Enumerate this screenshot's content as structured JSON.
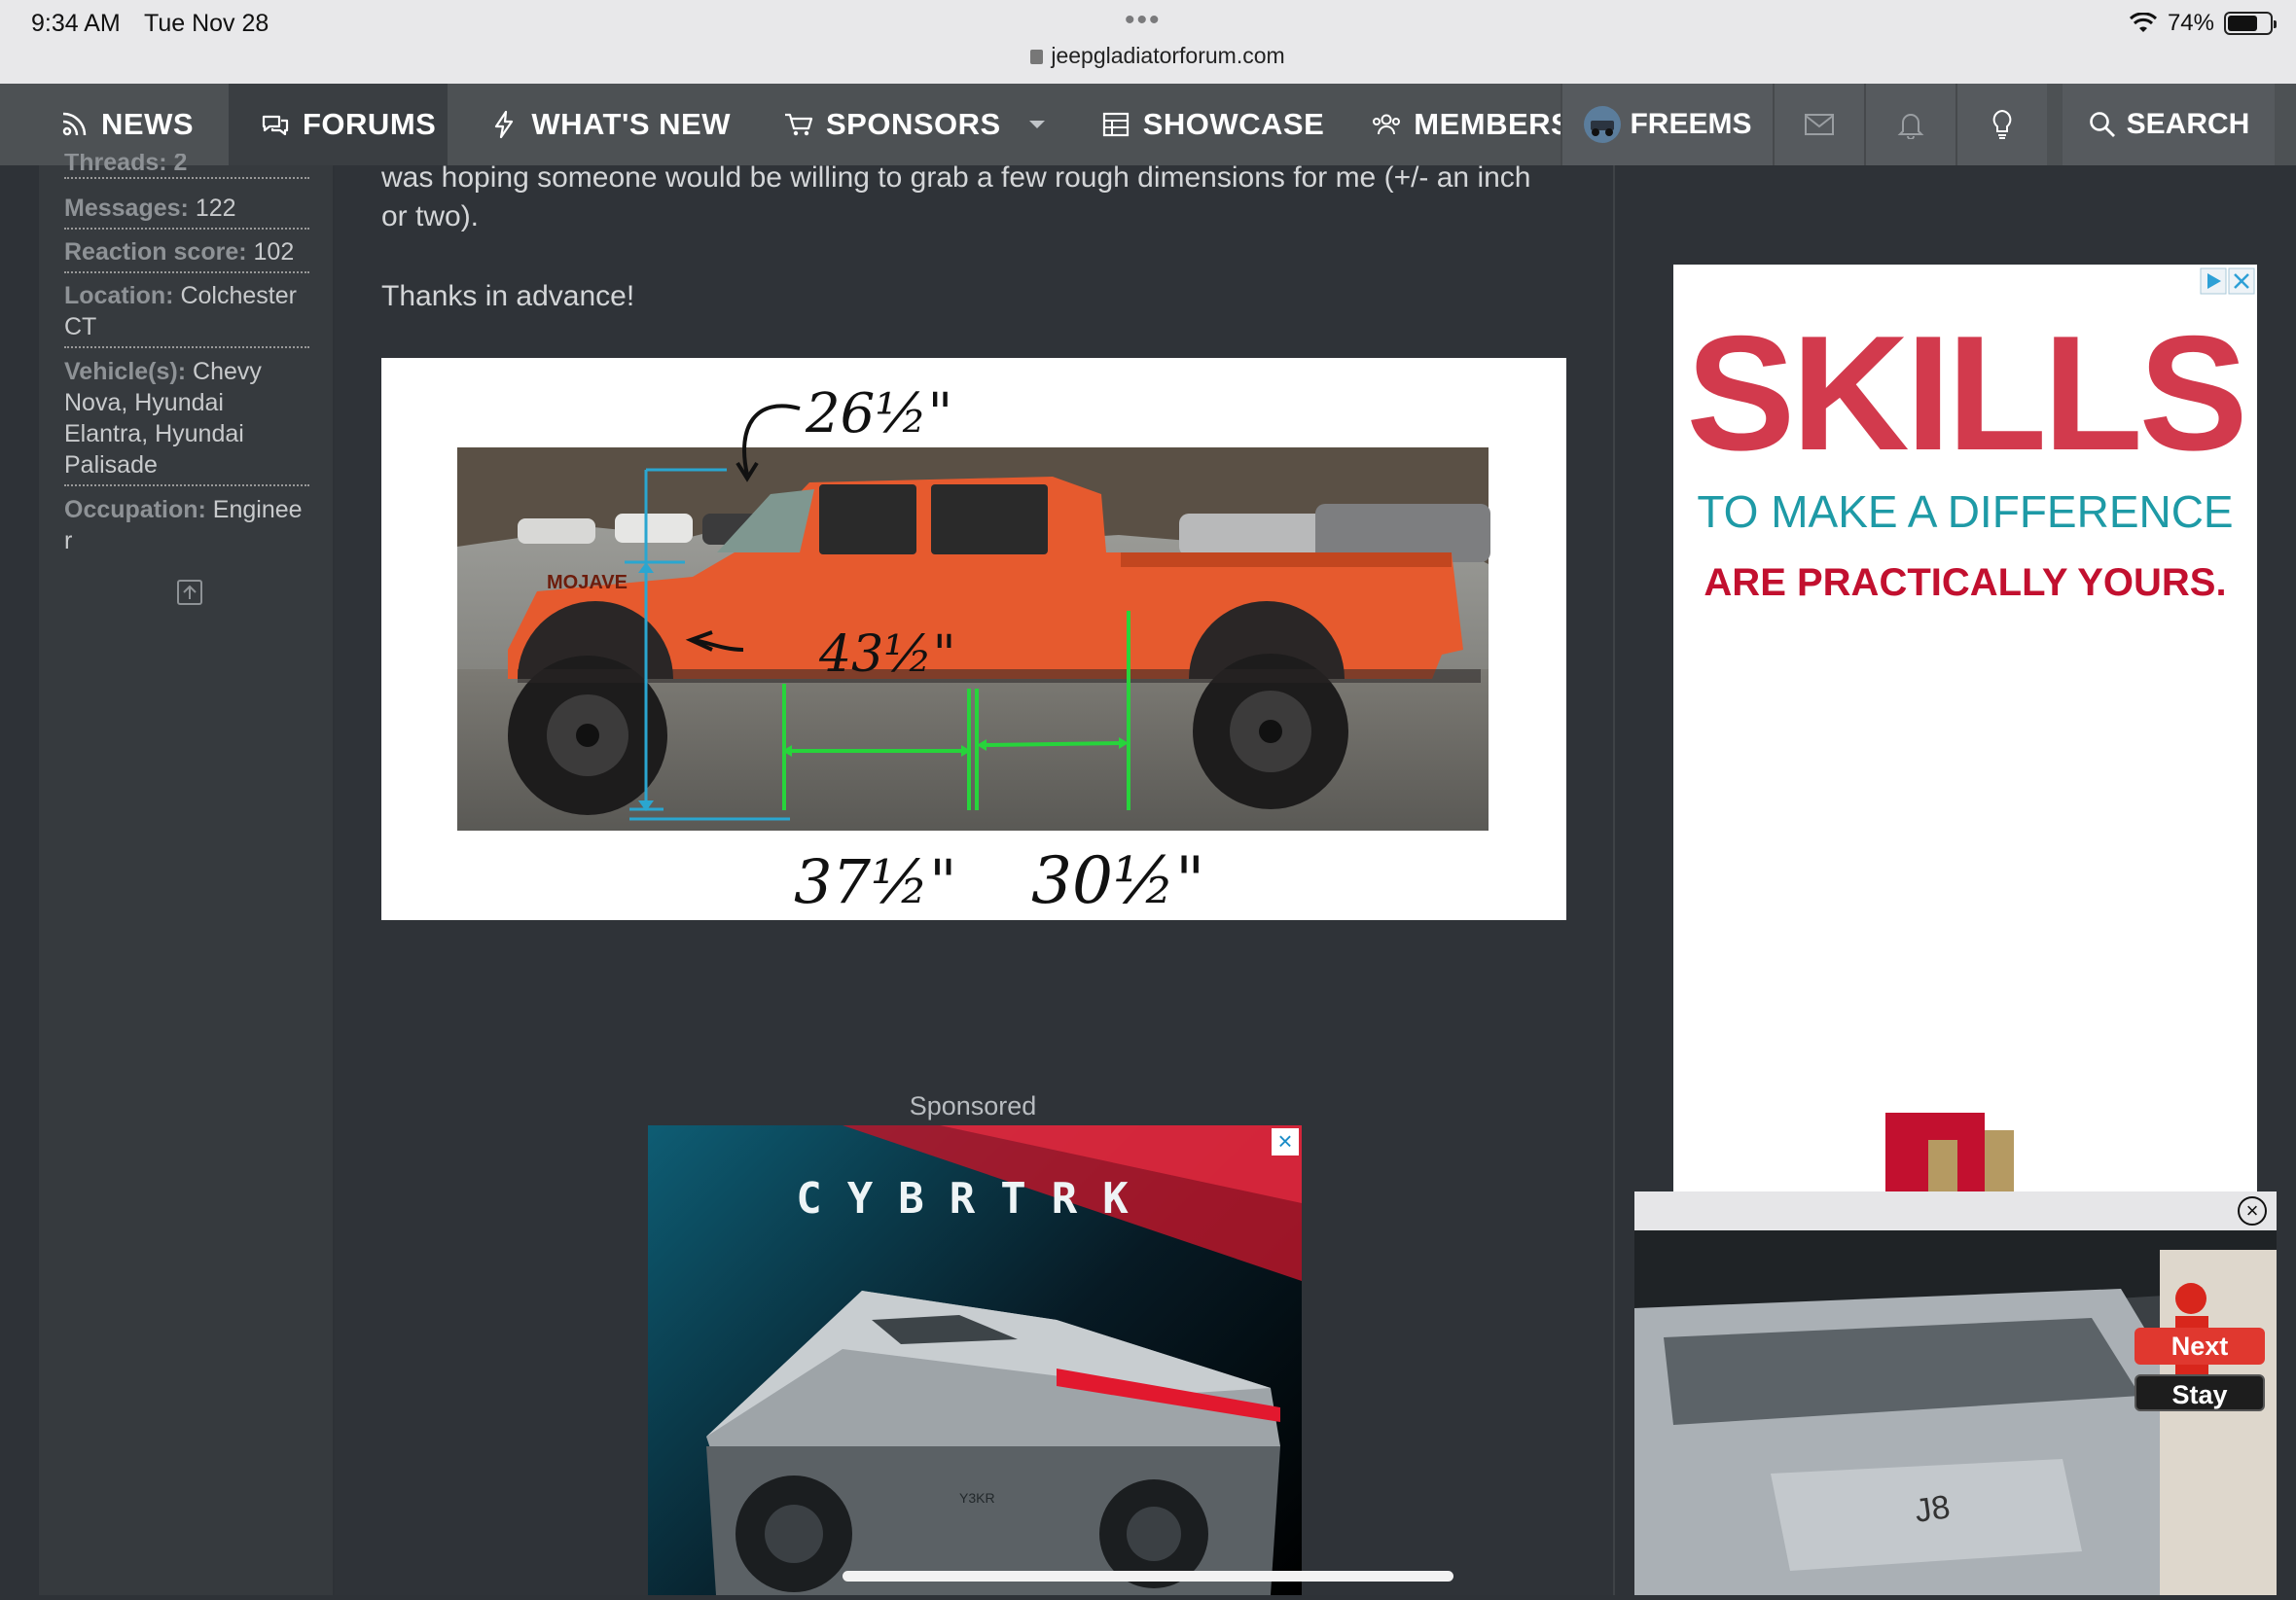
{
  "status": {
    "time": "9:34 AM",
    "date": "Tue Nov 28",
    "url": "jeepgladiatorforum.com",
    "battery": "74%"
  },
  "nav": {
    "items": [
      {
        "label": "NEWS",
        "icon": "news-icon"
      },
      {
        "label": "FORUMS",
        "icon": "chat-icon"
      },
      {
        "label": "WHAT'S NEW",
        "icon": "lightning-icon"
      },
      {
        "label": "SPONSORS",
        "icon": "cart-icon"
      },
      {
        "label": "SHOWCASE",
        "icon": "grid-icon"
      },
      {
        "label": "MEMBERS",
        "icon": "users-icon"
      }
    ],
    "freems": "FREEMS",
    "search": "SEARCH"
  },
  "profile": {
    "threads_partial": "Threads: 2",
    "messages_label": "Messages:",
    "messages_value": "122",
    "reaction_label": "Reaction score:",
    "reaction_value": "102",
    "location_label": "Location:",
    "location_value": "Colchester CT",
    "vehicles_label": "Vehicle(s):",
    "vehicles_value": "Chevy Nova, Hyundai Elantra, Hyundai Palisade",
    "occupation_label": "Occupation:",
    "occupation_value": "Engineer"
  },
  "post": {
    "line1": "was hoping someone would be willing to grab a few rough dimensions for me (+/- an inch",
    "line2": "or two).",
    "thanks": "Thanks in advance!",
    "annotations": {
      "top": "26½\"",
      "middle": "43½\"",
      "bottom_left": "37½\"",
      "bottom_right": "30½\"",
      "badge": "MOJAVE"
    }
  },
  "sponsored": {
    "label": "Sponsored",
    "brand": "CYBRTRK",
    "plate": "Y3KR"
  },
  "right_ad": {
    "headline": "SKILLS",
    "line1": "TO MAKE A DIFFERENCE",
    "line2": "ARE PRACTICALLY YOURS."
  },
  "video": {
    "next": "Next",
    "stay": "Stay",
    "badge": "J8"
  },
  "colors": {
    "nav_bg": "#4d5154",
    "page_bg": "#2e3237",
    "accent_red": "#c2102f",
    "accent_teal": "#1e9aa6",
    "truck_orange": "#e65a2e"
  }
}
